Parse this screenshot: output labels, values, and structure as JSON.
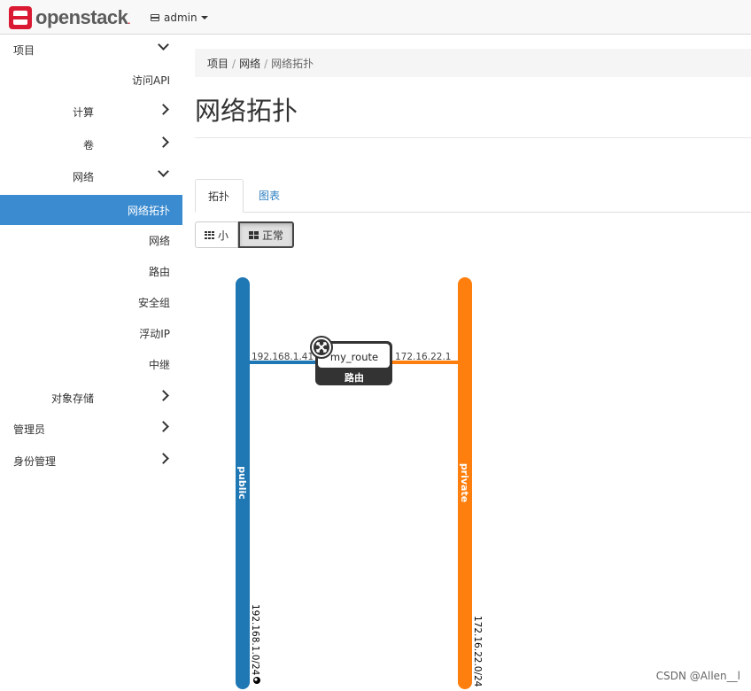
{
  "topbar": {
    "brand": "openstack",
    "brand_mark": ".",
    "project": "admin"
  },
  "sidebar": {
    "items": [
      {
        "label": "项目",
        "level": 0,
        "chevron": "down"
      },
      {
        "label": "访问API",
        "level": 2,
        "chevron": ""
      },
      {
        "label": "计算",
        "level": 1,
        "chevron": "right"
      },
      {
        "label": "卷",
        "level": 1,
        "chevron": "right"
      },
      {
        "label": "网络",
        "level": 1,
        "chevron": "down"
      },
      {
        "label": "网络拓扑",
        "level": 2,
        "chevron": "",
        "active": true
      },
      {
        "label": "网络",
        "level": 2,
        "chevron": ""
      },
      {
        "label": "路由",
        "level": 2,
        "chevron": ""
      },
      {
        "label": "安全组",
        "level": 2,
        "chevron": ""
      },
      {
        "label": "浮动IP",
        "level": 2,
        "chevron": ""
      },
      {
        "label": "中继",
        "level": 2,
        "chevron": ""
      },
      {
        "label": "对象存储",
        "level": 1,
        "chevron": "right"
      },
      {
        "label": "管理员",
        "level": 0,
        "chevron": "right"
      },
      {
        "label": "身份管理",
        "level": 0,
        "chevron": "right"
      }
    ]
  },
  "breadcrumb": {
    "items": [
      "项目",
      "网络",
      "网络拓扑"
    ],
    "sep": "/"
  },
  "page_title": "网络拓扑",
  "tabs": {
    "active": "拓扑",
    "inactive": "图表"
  },
  "view_buttons": {
    "small": "小",
    "normal": "正常"
  },
  "topology": {
    "networks": [
      {
        "name": "public",
        "cidr": "192.168.1.0/24",
        "color": "#1f77b4"
      },
      {
        "name": "private",
        "cidr": "172.16.22.0/24",
        "color": "#ff7f0e"
      }
    ],
    "router": {
      "name": "my_route",
      "type_label": "路由",
      "left_ip": "192.168.1.41",
      "right_ip": "172.16.22.1"
    }
  },
  "watermark": "CSDN @Allen__l",
  "colors": {
    "accent": "#3b8bd0",
    "brand": "#da1a32",
    "link": "#2f7fc1"
  }
}
